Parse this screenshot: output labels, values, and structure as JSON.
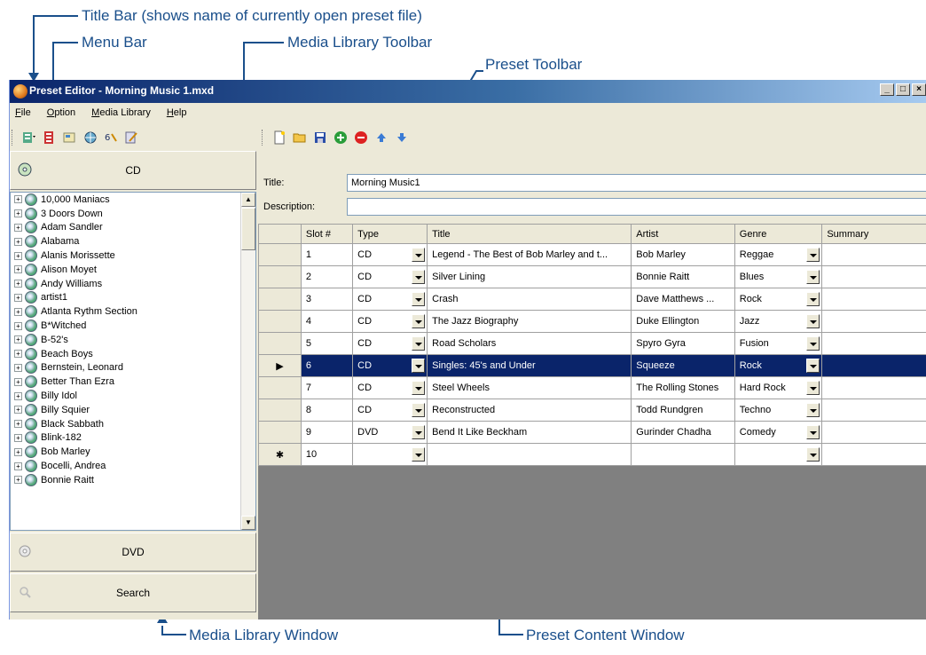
{
  "callouts": {
    "title_bar": "Title Bar (shows name of currently open preset file)",
    "menu_bar": "Menu Bar",
    "media_library_toolbar": "Media Library Toolbar",
    "preset_toolbar": "Preset Toolbar",
    "media_library_window": "Media Library Window",
    "preset_content_window": "Preset Content Window"
  },
  "window": {
    "title": "Preset Editor - Morning Music 1.mxd",
    "controls": [
      "_",
      "□",
      "×"
    ]
  },
  "menu": [
    {
      "accel": "F",
      "rest": "ile"
    },
    {
      "accel": "O",
      "rest": "ption"
    },
    {
      "accel": "M",
      "rest": "edia Library"
    },
    {
      "accel": "H",
      "rest": "elp"
    }
  ],
  "media_library": {
    "top_button": "CD",
    "bottom_buttons": [
      "DVD",
      "Search"
    ],
    "tree": [
      "10,000 Maniacs",
      "3 Doors Down",
      "Adam Sandler",
      "Alabama",
      "Alanis Morissette",
      "Alison Moyet",
      "Andy Williams",
      "artist1",
      "Atlanta Rythm Section",
      "B*Witched",
      "B-52's",
      "Beach Boys",
      "Bernstein, Leonard",
      "Better Than Ezra",
      "Billy Idol",
      "Billy Squier",
      "Black Sabbath",
      "Blink-182",
      "Bob Marley",
      "Bocelli, Andrea",
      "Bonnie Raitt"
    ]
  },
  "preset": {
    "title_label": "Title:",
    "title_value": "Morning Music1",
    "description_label": "Description:",
    "description_value": "",
    "columns": [
      "Slot #",
      "Type",
      "Title",
      "Artist",
      "Genre",
      "Summary"
    ],
    "rows": [
      {
        "slot": "1",
        "type": "CD",
        "title": "Legend - The Best of Bob Marley and t...",
        "artist": "Bob Marley",
        "genre": "Reggae",
        "summary": ""
      },
      {
        "slot": "2",
        "type": "CD",
        "title": "Silver Lining",
        "artist": "Bonnie Raitt",
        "genre": "Blues",
        "summary": ""
      },
      {
        "slot": "3",
        "type": "CD",
        "title": "Crash",
        "artist": "Dave Matthews ...",
        "genre": "Rock",
        "summary": ""
      },
      {
        "slot": "4",
        "type": "CD",
        "title": "The Jazz Biography",
        "artist": "Duke Ellington",
        "genre": "Jazz",
        "summary": ""
      },
      {
        "slot": "5",
        "type": "CD",
        "title": "Road Scholars",
        "artist": "Spyro Gyra",
        "genre": "Fusion",
        "summary": ""
      },
      {
        "slot": "6",
        "type": "CD",
        "title": "Singles: 45's and Under",
        "artist": "Squeeze",
        "genre": "Rock",
        "summary": "",
        "selected": true
      },
      {
        "slot": "7",
        "type": "CD",
        "title": "Steel Wheels",
        "artist": "The Rolling Stones",
        "genre": "Hard Rock",
        "summary": ""
      },
      {
        "slot": "8",
        "type": "CD",
        "title": "Reconstructed",
        "artist": "Todd Rundgren",
        "genre": "Techno",
        "summary": ""
      },
      {
        "slot": "9",
        "type": "DVD",
        "title": "Bend It Like Beckham",
        "artist": "Gurinder Chadha",
        "genre": "Comedy",
        "summary": ""
      },
      {
        "slot": "10",
        "type": "",
        "title": "",
        "artist": "",
        "genre": "",
        "summary": "",
        "new_row": true
      }
    ],
    "new_row_marker": "✱",
    "selected_marker": "▶"
  },
  "colors": {
    "callout": "#1a4f8b",
    "selection": "#0a246a",
    "window_bg": "#ece9d8",
    "grid_bg": "#808080"
  }
}
